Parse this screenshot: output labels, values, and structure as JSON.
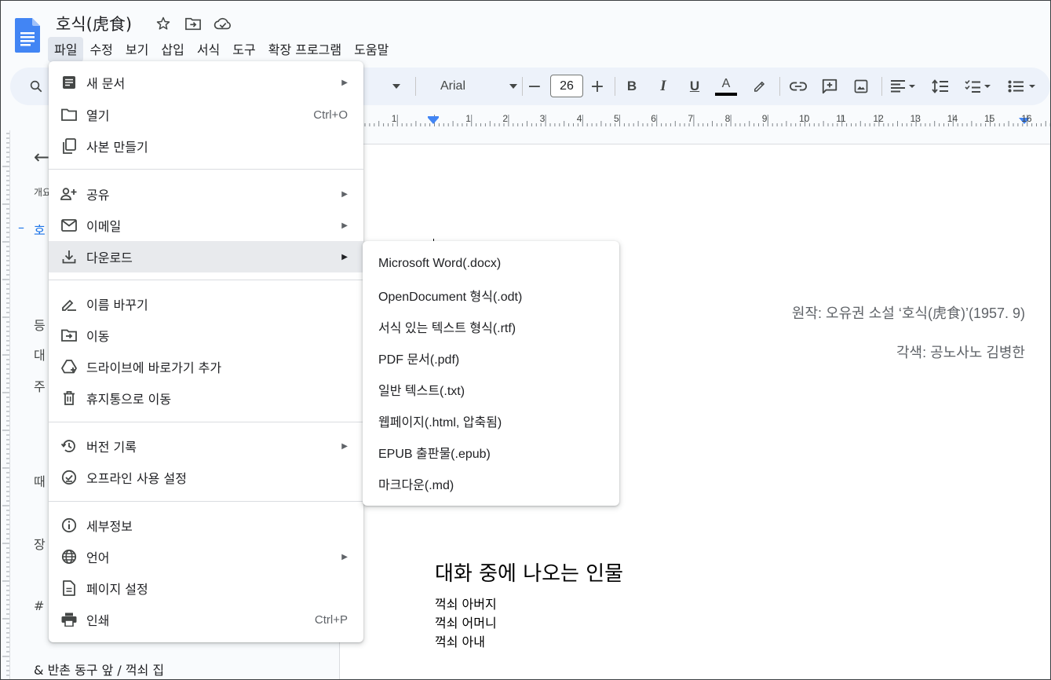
{
  "app": {
    "doc_title": "호식(虎食)",
    "title_icons": [
      "star-icon",
      "move-to-folder-icon",
      "cloud-saved-icon"
    ]
  },
  "menubar": [
    "파일",
    "수정",
    "보기",
    "삽입",
    "서식",
    "도구",
    "확장 프로그램",
    "도움말"
  ],
  "toolbar": {
    "font": "Arial",
    "font_size": "26",
    "minus": "−",
    "plus": "+",
    "bold": "B",
    "italic": "I",
    "underline": "U",
    "text_color_letter": "A",
    "text_color": "#000000",
    "icons": [
      "search-icon",
      "style-dropdown-icon",
      "font-dropdown-icon",
      "bold-icon",
      "italic-icon",
      "underline-icon",
      "text-color-icon",
      "highlight-icon",
      "link-icon",
      "comment-icon",
      "image-icon",
      "align-icon",
      "line-spacing-icon",
      "checklist-icon",
      "bullet-list-icon"
    ]
  },
  "ruler": {
    "numbers": [
      "1",
      "1",
      "2",
      "3",
      "4",
      "5",
      "6",
      "7",
      "8",
      "9",
      "10",
      "11",
      "12",
      "13",
      "14",
      "15",
      "16"
    ]
  },
  "outline": {
    "back": "←",
    "section_label": "개요",
    "active_item_dash": "–",
    "active_item": "호",
    "truncated_items": [
      "등",
      "대",
      "주",
      "때",
      "장"
    ],
    "hash_item": "#",
    "bottom_item": "& 반촌 동구 앞 / 꺽쇠 집"
  },
  "document": {
    "original_credit": "원작: 오유권 소설 ‘호식(虎食)’(1957. 9)",
    "adaptation_credit": "각색: 공노사노 김병한",
    "heading": "대화 중에 나오는 인물",
    "characters": [
      "꺽쇠 아버지",
      "꺽쇠 어머니",
      "꺽쇠 아내"
    ]
  },
  "file_menu": {
    "items": [
      {
        "label": "새 문서",
        "icon": "new-document-icon",
        "submenu": true,
        "shortcut": ""
      },
      {
        "label": "열기",
        "icon": "folder-open-icon",
        "submenu": false,
        "shortcut": "Ctrl+O"
      },
      {
        "label": "사본 만들기",
        "icon": "copy-icon",
        "submenu": false,
        "shortcut": ""
      },
      {
        "label": "공유",
        "icon": "share-person-icon",
        "submenu": true,
        "shortcut": ""
      },
      {
        "label": "이메일",
        "icon": "email-icon",
        "submenu": true,
        "shortcut": ""
      },
      {
        "label": "다운로드",
        "icon": "download-icon",
        "submenu": true,
        "shortcut": ""
      },
      {
        "label": "이름 바꾸기",
        "icon": "rename-icon",
        "submenu": false,
        "shortcut": ""
      },
      {
        "label": "이동",
        "icon": "move-icon",
        "submenu": false,
        "shortcut": ""
      },
      {
        "label": "드라이브에 바로가기 추가",
        "icon": "drive-shortcut-icon",
        "submenu": false,
        "shortcut": ""
      },
      {
        "label": "휴지통으로 이동",
        "icon": "trash-icon",
        "submenu": false,
        "shortcut": ""
      },
      {
        "label": "버전 기록",
        "icon": "history-icon",
        "submenu": true,
        "shortcut": ""
      },
      {
        "label": "오프라인 사용 설정",
        "icon": "offline-check-icon",
        "submenu": false,
        "shortcut": ""
      },
      {
        "label": "세부정보",
        "icon": "info-icon",
        "submenu": false,
        "shortcut": ""
      },
      {
        "label": "언어",
        "icon": "globe-icon",
        "submenu": true,
        "shortcut": ""
      },
      {
        "label": "페이지 설정",
        "icon": "page-setup-icon",
        "submenu": false,
        "shortcut": ""
      },
      {
        "label": "인쇄",
        "icon": "print-icon",
        "submenu": false,
        "shortcut": "Ctrl+P"
      }
    ],
    "highlighted": "다운로드"
  },
  "download_submenu": [
    "Microsoft Word(.docx)",
    "OpenDocument 형식(.odt)",
    "서식 있는 텍스트 형식(.rtf)",
    "PDF 문서(.pdf)",
    "일반 텍스트(.txt)",
    "웹페이지(.html, 압축됨)",
    "EPUB 출판물(.epub)",
    "마크다운(.md)"
  ],
  "colors": {
    "accent": "#1a73e8",
    "doc_icon": "#4285f4",
    "menu_highlight": "#e8eaed",
    "toolbar_bg": "#edf2fa"
  }
}
